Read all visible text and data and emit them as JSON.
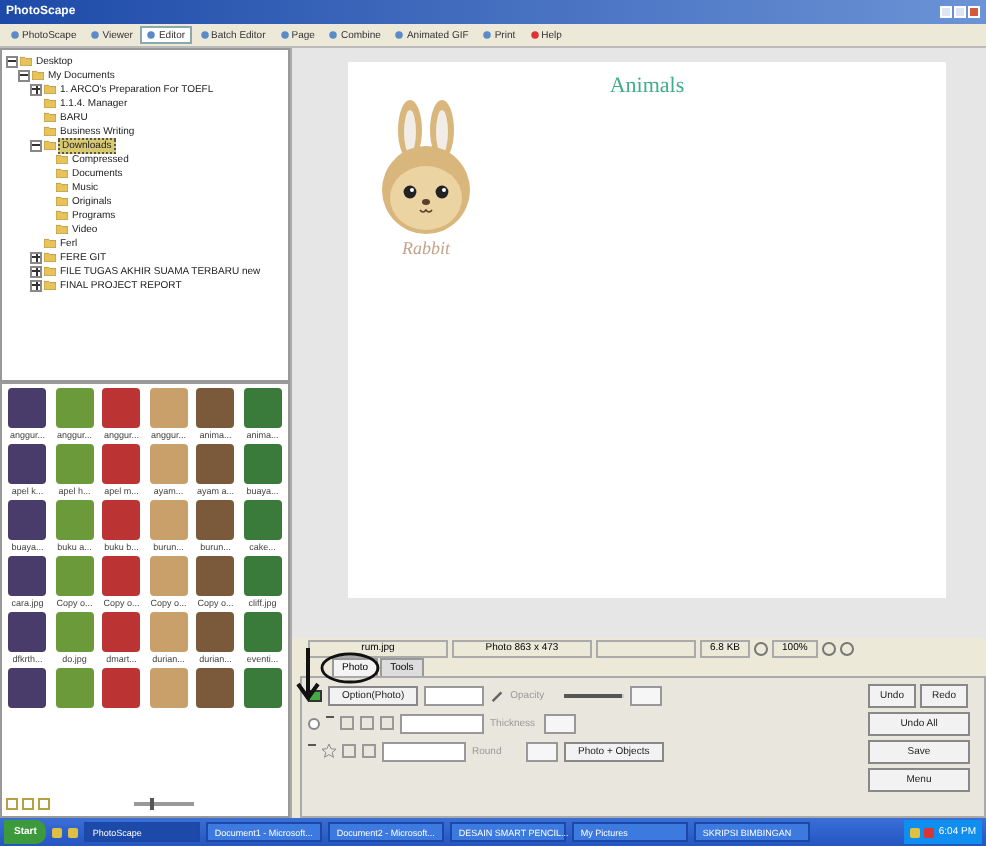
{
  "window": {
    "title": "PhotoScape"
  },
  "toolbar": [
    {
      "label": "PhotoScape",
      "selected": false
    },
    {
      "label": "Viewer",
      "selected": false
    },
    {
      "label": "Editor",
      "selected": true
    },
    {
      "label": "Batch Editor",
      "selected": false
    },
    {
      "label": "Page",
      "selected": false
    },
    {
      "label": "Combine",
      "selected": false
    },
    {
      "label": "Animated GIF",
      "selected": false
    },
    {
      "label": "Print",
      "selected": false
    },
    {
      "label": "Help",
      "selected": false
    }
  ],
  "folder_tree": [
    {
      "label": "Desktop",
      "selected": false,
      "expanded": true,
      "children": [
        {
          "label": "My Documents",
          "selected": false,
          "expanded": true,
          "children": [
            {
              "label": "1. ARCO's Preparation For TOEFL",
              "selected": false,
              "expanded": false
            },
            {
              "label": "1.1.4. Manager",
              "selected": false
            },
            {
              "label": "BARU",
              "selected": false
            },
            {
              "label": "Business Writing",
              "selected": false
            },
            {
              "label": "Downloads",
              "selected": true,
              "expanded": true,
              "children": [
                {
                  "label": "Compressed",
                  "selected": false
                },
                {
                  "label": "Documents",
                  "selected": false
                },
                {
                  "label": "Music",
                  "selected": false
                },
                {
                  "label": "Originals",
                  "selected": false
                },
                {
                  "label": "Programs",
                  "selected": false
                },
                {
                  "label": "Video",
                  "selected": false
                }
              ]
            },
            {
              "label": "Ferl",
              "selected": false
            },
            {
              "label": "FERE GIT",
              "selected": false,
              "expanded": false
            },
            {
              "label": "FILE TUGAS AKHIR SUAMA TERBARU new",
              "selected": false,
              "expanded": false
            },
            {
              "label": "FINAL PROJECT REPORT",
              "selected": false,
              "expanded": false
            }
          ]
        }
      ]
    }
  ],
  "thumbnails": [
    {
      "label": "anggur..."
    },
    {
      "label": "anggur..."
    },
    {
      "label": "anggur..."
    },
    {
      "label": "anggur..."
    },
    {
      "label": "anima..."
    },
    {
      "label": "anima..."
    },
    {
      "label": "apel k..."
    },
    {
      "label": "apel h..."
    },
    {
      "label": "apel m..."
    },
    {
      "label": "ayam..."
    },
    {
      "label": "ayam a..."
    },
    {
      "label": "buaya..."
    },
    {
      "label": "buaya..."
    },
    {
      "label": "buku a..."
    },
    {
      "label": "buku b..."
    },
    {
      "label": "burun..."
    },
    {
      "label": "burun..."
    },
    {
      "label": "cake..."
    },
    {
      "label": "cara.jpg"
    },
    {
      "label": "Copy o..."
    },
    {
      "label": "Copy o..."
    },
    {
      "label": "Copy o..."
    },
    {
      "label": "Copy o..."
    },
    {
      "label": "cliff.jpg"
    },
    {
      "label": "dfkrth..."
    },
    {
      "label": "do.jpg"
    },
    {
      "label": "dmart..."
    },
    {
      "label": "durian..."
    },
    {
      "label": "durian..."
    },
    {
      "label": "eventi..."
    }
  ],
  "thumbnail_size": {
    "level": 0.25
  },
  "opacity": {
    "level": 0.95
  },
  "text_radio": {
    "checked": false
  },
  "page": {
    "title": "Animals",
    "caption": "Rabbit"
  },
  "status_bar": {
    "file": "rum.jpg",
    "dimensions": "Photo 863 x 473",
    "size": "6.8 KB",
    "zoom": "100%"
  },
  "editor_tabs": [
    {
      "label": "Photo",
      "selected": true
    },
    {
      "label": "Tools",
      "selected": false
    }
  ],
  "option_button": "Option(Photo)",
  "control_labels": [
    "Opacity",
    "Thickness",
    "Round"
  ],
  "objects_button": "Photo + Objects",
  "actions": [
    "Undo",
    "Redo",
    "Undo All",
    "Save",
    "Menu"
  ],
  "taskbar": {
    "start": "Start",
    "items": [
      {
        "label": "PhotoScape",
        "selected": true
      },
      {
        "label": "Document1 - Microsoft...",
        "selected": false
      },
      {
        "label": "Document2 - Microsoft...",
        "selected": false
      },
      {
        "label": "DESAIN SMART PENCIL...",
        "selected": false
      },
      {
        "label": "My Pictures",
        "selected": false
      },
      {
        "label": "SKRIPSI BIMBINGAN",
        "selected": false
      }
    ],
    "clock": "6:04 PM"
  }
}
